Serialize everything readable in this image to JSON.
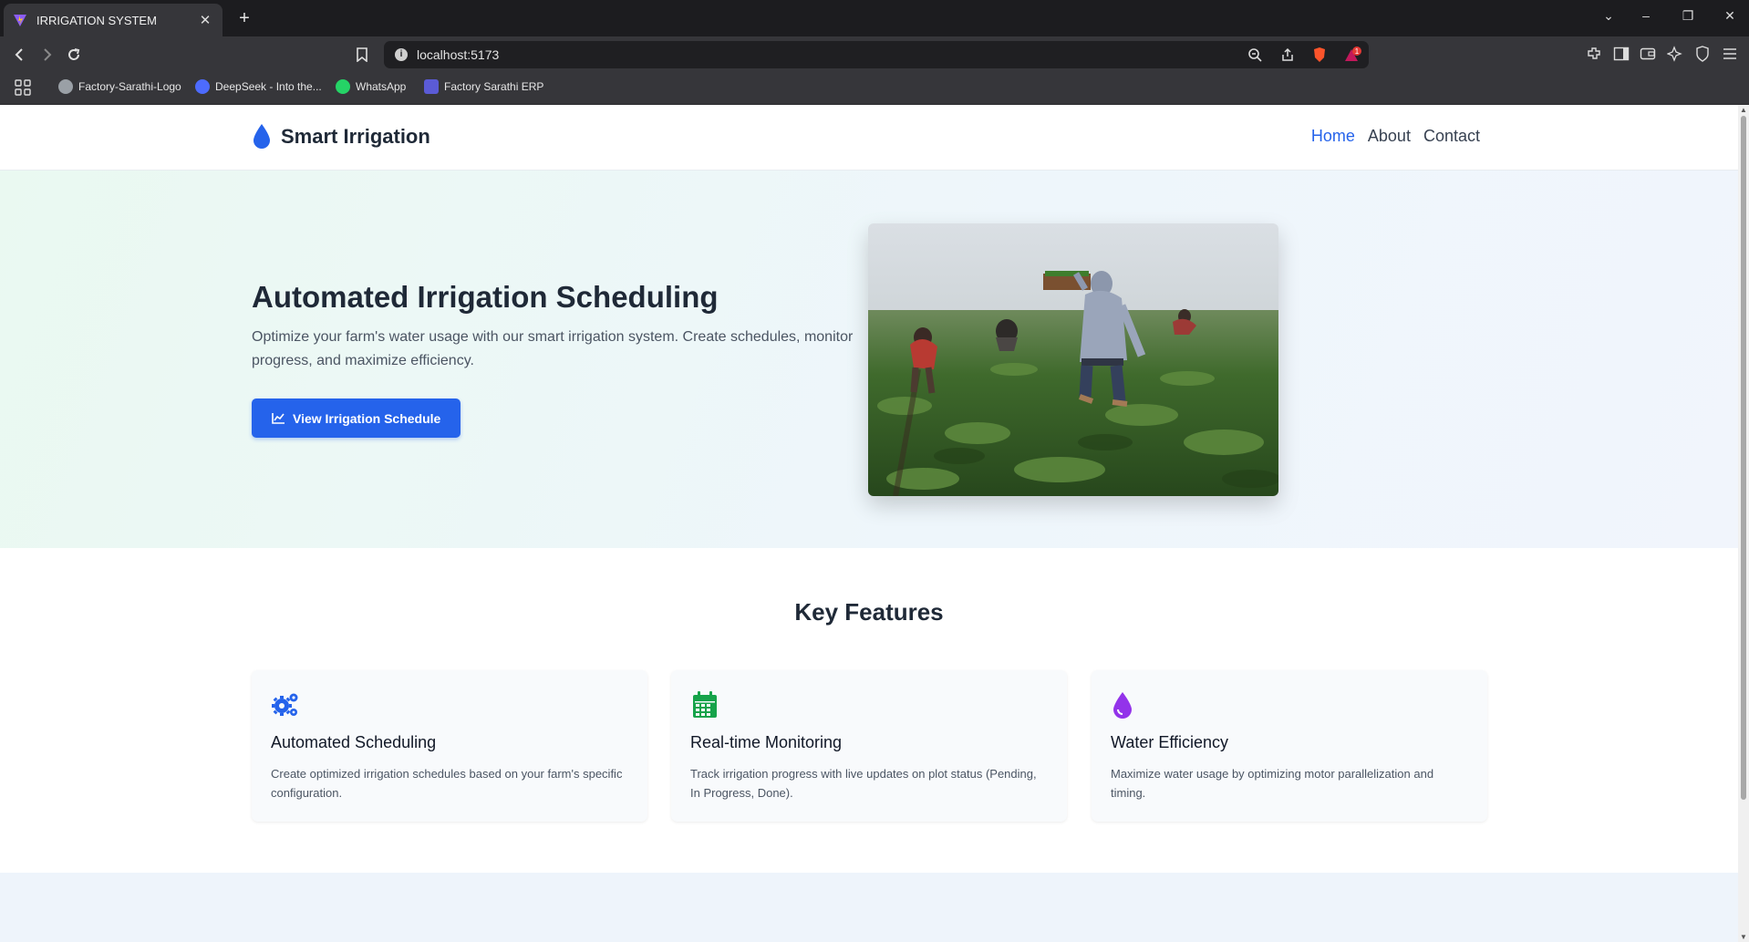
{
  "browser": {
    "tab_title": "IRRIGATION SYSTEM",
    "url": "localhost:5173",
    "brave_badge_count": "1",
    "bookmarks": [
      {
        "label": "Factory-Sarathi-Logo",
        "icon": "globe-icon"
      },
      {
        "label": "DeepSeek - Into the...",
        "icon": "deepseek-icon"
      },
      {
        "label": "WhatsApp",
        "icon": "whatsapp-icon"
      },
      {
        "label": "Factory Sarathi ERP",
        "icon": "factory-sarathi-icon"
      }
    ]
  },
  "site": {
    "brand": "Smart Irrigation",
    "nav": [
      "Home",
      "About",
      "Contact"
    ],
    "active_nav": "Home",
    "accent_color": "#2563eb"
  },
  "hero": {
    "title": "Automated Irrigation Scheduling",
    "subtitle": "Optimize your farm's water usage with our smart irrigation system. Create schedules, monitor progress, and maximize efficiency.",
    "button_label": "View Irrigation Schedule",
    "button_icon": "chart-line-icon",
    "image": "farm-workers-field-photo"
  },
  "features": {
    "title": "Key Features",
    "items": [
      {
        "title": "Automated Scheduling",
        "desc": "Create optimized irrigation schedules based on your farm's specific configuration.",
        "icon": "gears-icon",
        "color": "#2563eb"
      },
      {
        "title": "Real-time Monitoring",
        "desc": "Track irrigation progress with live updates on plot status (Pending, In Progress, Done).",
        "icon": "calendar-icon",
        "color": "#16a34a"
      },
      {
        "title": "Water Efficiency",
        "desc": "Maximize water usage by optimizing motor parallelization and timing.",
        "icon": "water-drop-icon",
        "color": "#9333ea"
      }
    ]
  }
}
